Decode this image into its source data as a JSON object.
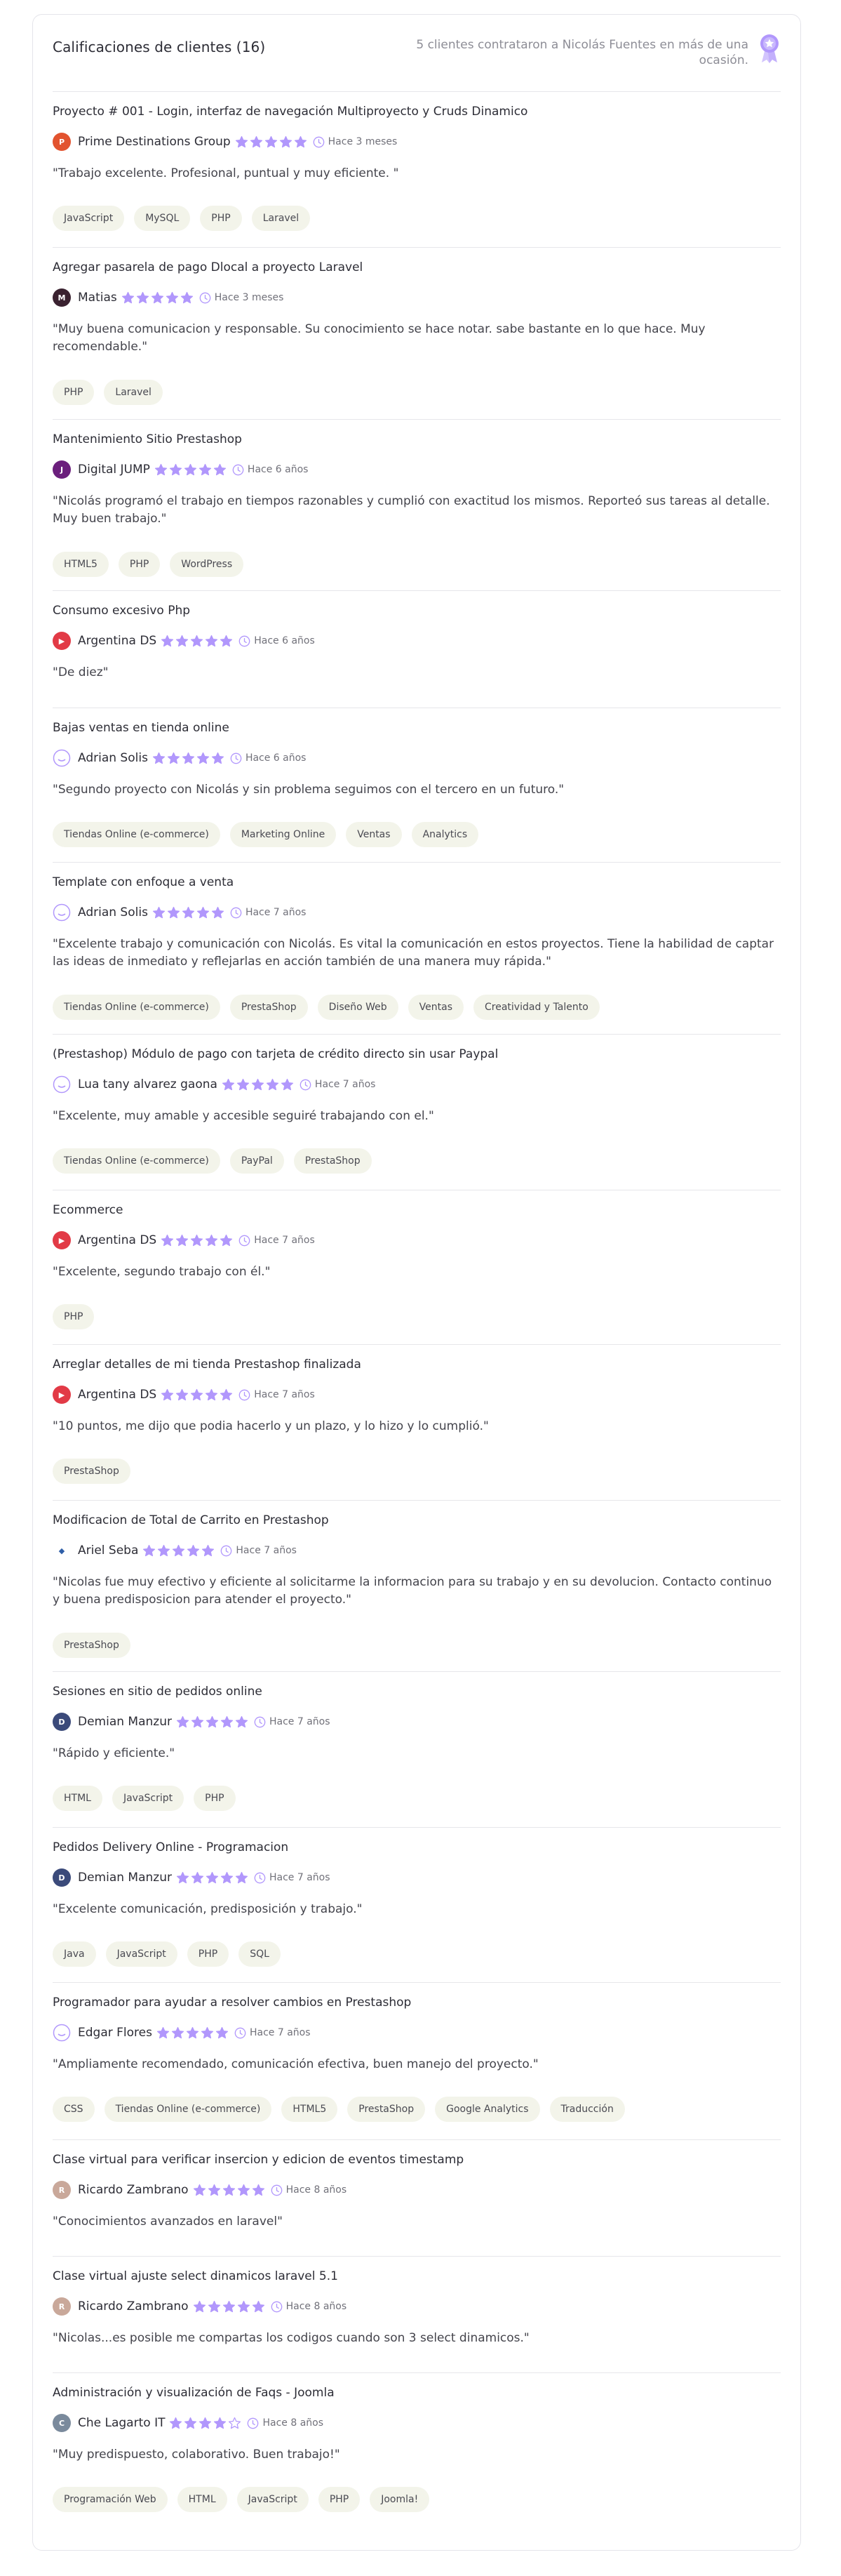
{
  "header": {
    "title": "Calificaciones de clientes (16)",
    "note": "5 clientes contrataron a Nicolás Fuentes en más de una ocasión.",
    "badge_icon": "award-ribbon-icon"
  },
  "colors": {
    "star": "#b197fc",
    "tag_bg": "#f3f4ea",
    "divider": "#e6e6ea"
  },
  "reviews": [
    {
      "title": "Proyecto # 001 - Login, interfaz de navegación Multiproyecto y Cruds Dinamico",
      "client": "Prime Destinations Group",
      "rating": 5,
      "time": "Hace 3 meses",
      "quote": "\"Trabajo excelente. Profesional, puntual y muy eficiente. \"",
      "tags": [
        "JavaScript",
        "MySQL",
        "PHP",
        "Laravel"
      ]
    },
    {
      "title": "Agregar pasarela de pago Dlocal a proyecto Laravel",
      "client": "Matias",
      "rating": 5,
      "time": "Hace 3 meses",
      "quote": "\"Muy buena comunicacion y responsable. Su conocimiento se hace notar. sabe bastante en lo que hace. Muy recomendable.\"",
      "tags": [
        "PHP",
        "Laravel"
      ]
    },
    {
      "title": "Mantenimiento Sitio Prestashop",
      "client": "Digital JUMP",
      "rating": 5,
      "time": "Hace 6 años",
      "quote": "\"Nicolás programó el trabajo en tiempos razonables y cumplió con exactitud los mismos. Reporteó sus tareas al detalle. Muy buen trabajo.\"",
      "tags": [
        "HTML5",
        "PHP",
        "WordPress"
      ]
    },
    {
      "title": "Consumo excesivo Php",
      "client": "Argentina DS",
      "rating": 5,
      "time": "Hace 6 años",
      "quote": "\"De diez\"",
      "tags": []
    },
    {
      "title": "Bajas ventas en tienda online",
      "client": "Adrian Solis",
      "rating": 5,
      "time": "Hace 6 años",
      "quote": "\"Segundo proyecto con Nicolás y sin problema seguimos con el tercero en un futuro.\"",
      "tags": [
        "Tiendas Online (e-commerce)",
        "Marketing Online",
        "Ventas",
        "Analytics"
      ]
    },
    {
      "title": "Template con enfoque a venta",
      "client": "Adrian Solis",
      "rating": 5,
      "time": "Hace 7 años",
      "quote": "\"Excelente trabajo y comunicación con Nicolás. Es vital la comunicación en estos proyectos. Tiene la habilidad de captar las ideas de inmediato y reflejarlas en acción también de una manera muy rápida.\"",
      "tags": [
        "Tiendas Online (e-commerce)",
        "PrestaShop",
        "Diseño Web",
        "Ventas",
        "Creatividad y Talento"
      ]
    },
    {
      "title": "(Prestashop) Módulo de pago con tarjeta de crédito directo sin usar Paypal",
      "client": "Lua tany alvarez gaona",
      "rating": 5,
      "time": "Hace 7 años",
      "quote": "\"Excelente, muy amable y accesible seguiré trabajando con el.\"",
      "tags": [
        "Tiendas Online (e-commerce)",
        "PayPal",
        "PrestaShop"
      ]
    },
    {
      "title": "Ecommerce",
      "client": "Argentina DS",
      "rating": 5,
      "time": "Hace 7 años",
      "quote": "\"Excelente, segundo trabajo con él.\"",
      "tags": [
        "PHP"
      ]
    },
    {
      "title": "Arreglar detalles de mi tienda Prestashop finalizada",
      "client": "Argentina DS",
      "rating": 5,
      "time": "Hace 7 años",
      "quote": "\"10 puntos, me dijo que podia hacerlo y un plazo, y lo hizo y lo cumplió.\"",
      "tags": [
        "PrestaShop"
      ]
    },
    {
      "title": "Modificacion de Total de Carrito en Prestashop",
      "client": "Ariel Seba",
      "rating": 5,
      "time": "Hace 7 años",
      "quote": "\"Nicolas fue muy efectivo y eficiente al solicitarme la informacion para su trabajo y en su devolucion. Contacto continuo y buena predisposicion para atender el proyecto.\"",
      "tags": [
        "PrestaShop"
      ]
    },
    {
      "title": "Sesiones en sitio de pedidos online",
      "client": "Demian Manzur",
      "rating": 5,
      "time": "Hace 7 años",
      "quote": "\"Rápido y eficiente.\"",
      "tags": [
        "HTML",
        "JavaScript",
        "PHP"
      ]
    },
    {
      "title": "Pedidos Delivery Online - Programacion",
      "client": "Demian Manzur",
      "rating": 5,
      "time": "Hace 7 años",
      "quote": "\"Excelente comunicación, predisposición y trabajo.\"",
      "tags": [
        "Java",
        "JavaScript",
        "PHP",
        "SQL"
      ]
    },
    {
      "title": "Programador para ayudar a resolver cambios en Prestashop",
      "client": "Edgar Flores",
      "rating": 5,
      "time": "Hace 7 años",
      "quote": "\"Ampliamente recomendado, comunicación efectiva, buen manejo del proyecto.\"",
      "tags": [
        "CSS",
        "Tiendas Online (e-commerce)",
        "HTML5",
        "PrestaShop",
        "Google Analytics",
        "Traducción"
      ]
    },
    {
      "title": "Clase virtual para verificar insercion y edicion de eventos timestamp",
      "client": "Ricardo Zambrano",
      "rating": 5,
      "time": "Hace 8 años",
      "quote": "\"Conocimientos avanzados en laravel\"",
      "tags": []
    },
    {
      "title": "Clase virtual ajuste select dinamicos laravel 5.1",
      "client": "Ricardo Zambrano",
      "rating": 5,
      "time": "Hace 8 años",
      "quote": "\"Nicolas...es posible me compartas los codigos cuando son 3 select dinamicos.\"",
      "tags": []
    },
    {
      "title": "Administración y visualización de Faqs - Joomla",
      "client": "Che Lagarto IT",
      "rating": 4,
      "time": "Hace 8 años",
      "quote": "\"Muy predispuesto, colaborativo. Buen trabajo!\"",
      "tags": [
        "Programación Web",
        "HTML",
        "JavaScript",
        "PHP",
        "Joomla!"
      ]
    }
  ]
}
